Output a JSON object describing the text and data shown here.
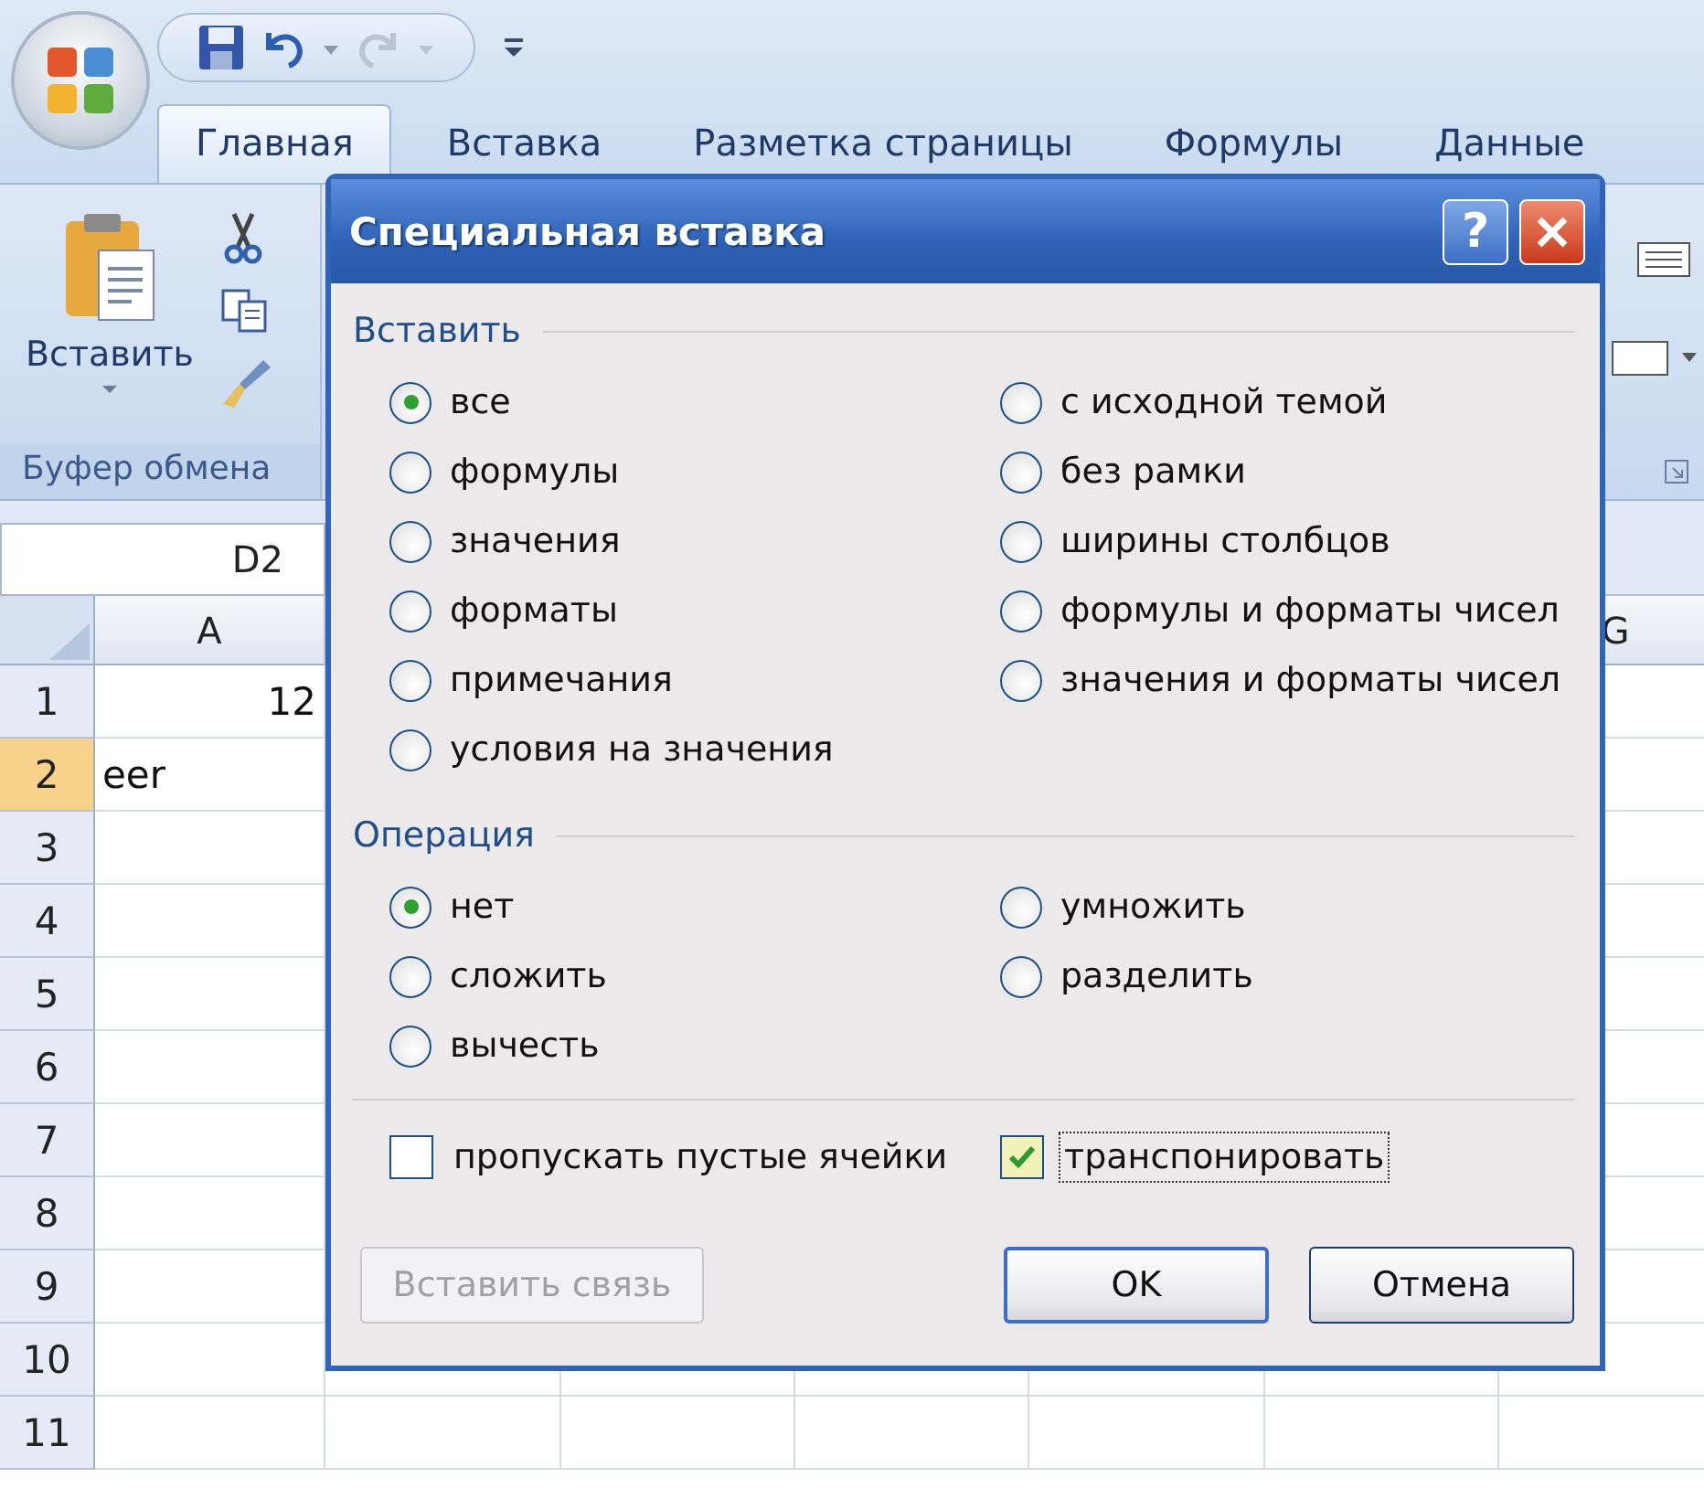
{
  "ribbon_tabs": [
    {
      "label": "Главная",
      "selected": true
    },
    {
      "label": "Вставка",
      "selected": false
    },
    {
      "label": "Разметка страницы",
      "selected": false
    },
    {
      "label": "Формулы",
      "selected": false
    },
    {
      "label": "Данные",
      "selected": false
    }
  ],
  "clipboard_group": {
    "paste_label": "Вставить",
    "group_label": "Буфер обмена"
  },
  "name_box": "D2",
  "columns": [
    {
      "label": "A"
    },
    {
      "label": "G"
    }
  ],
  "rows": [
    {
      "header": "1",
      "selected": false,
      "cells": [
        {
          "text": "12",
          "kind": "number"
        }
      ]
    },
    {
      "header": "2",
      "selected": true,
      "cells": [
        {
          "text": "eer",
          "kind": "text"
        }
      ]
    },
    {
      "header": "3",
      "selected": false,
      "cells": []
    },
    {
      "header": "4",
      "selected": false,
      "cells": []
    },
    {
      "header": "5",
      "selected": false,
      "cells": []
    },
    {
      "header": "6",
      "selected": false,
      "cells": []
    },
    {
      "header": "7",
      "selected": false,
      "cells": []
    },
    {
      "header": "8",
      "selected": false,
      "cells": []
    },
    {
      "header": "9",
      "selected": false,
      "cells": []
    },
    {
      "header": "10",
      "selected": false,
      "cells": []
    },
    {
      "header": "11",
      "selected": false,
      "cells": []
    }
  ],
  "dialog": {
    "title": "Специальная вставка",
    "help": "?",
    "sections": [
      {
        "title": "Вставить",
        "columns": [
          [
            {
              "label": "все",
              "selected": true
            },
            {
              "label": "формулы",
              "selected": false
            },
            {
              "label": "значения",
              "selected": false
            },
            {
              "label": "форматы",
              "selected": false
            },
            {
              "label": "примечания",
              "selected": false
            },
            {
              "label": "условия на значения",
              "selected": false
            }
          ],
          [
            {
              "label": "с исходной темой",
              "selected": false
            },
            {
              "label": "без рамки",
              "selected": false
            },
            {
              "label": "ширины столбцов",
              "selected": false
            },
            {
              "label": "формулы и форматы чисел",
              "selected": false
            },
            {
              "label": "значения и форматы чисел",
              "selected": false
            }
          ]
        ]
      },
      {
        "title": "Операция",
        "columns": [
          [
            {
              "label": "нет",
              "selected": true
            },
            {
              "label": "сложить",
              "selected": false
            },
            {
              "label": "вычесть",
              "selected": false
            }
          ],
          [
            {
              "label": "умножить",
              "selected": false
            },
            {
              "label": "разделить",
              "selected": false
            }
          ]
        ]
      }
    ],
    "checkboxes": [
      {
        "label": "пропускать пустые ячейки",
        "checked": false,
        "focused": false
      },
      {
        "label": "транспонировать",
        "checked": true,
        "focused": true
      }
    ],
    "buttons": [
      {
        "label": "Вставить связь",
        "disabled": true,
        "default": false
      },
      {
        "label": "OK",
        "disabled": false,
        "default": true
      },
      {
        "label": "Отмена",
        "disabled": false,
        "default": false
      }
    ]
  }
}
